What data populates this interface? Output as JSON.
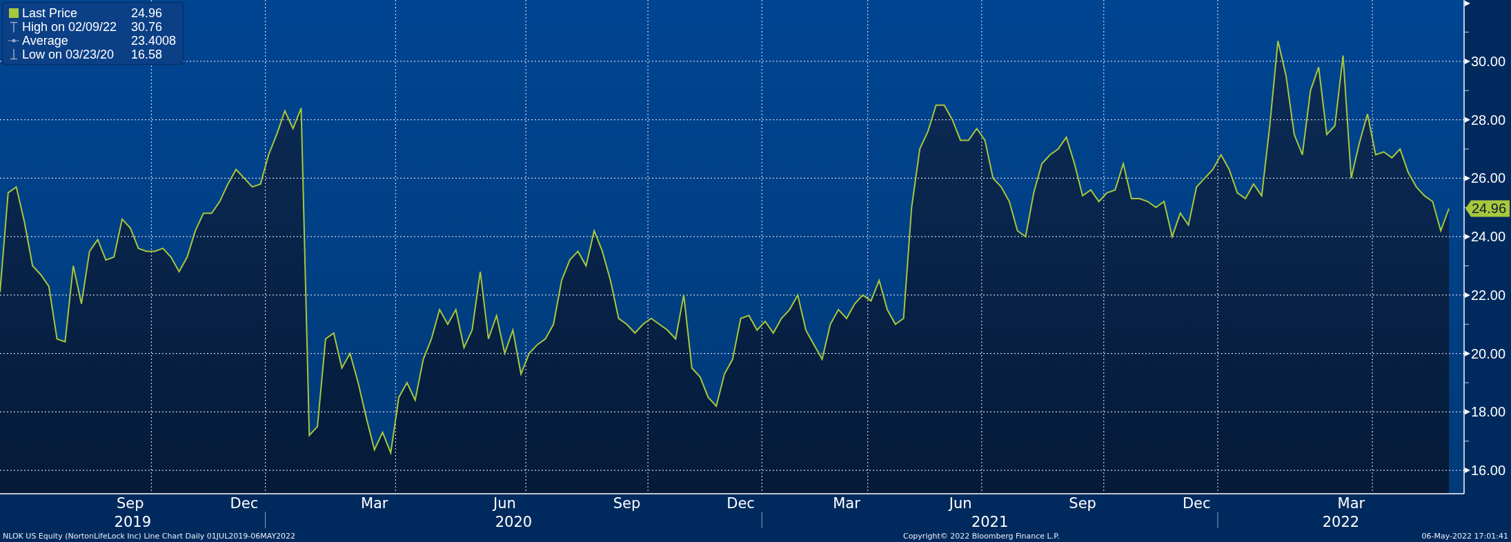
{
  "legend": [
    {
      "kind": "series",
      "value": "24.96"
    },
    {
      "kind": "high",
      "label": "High on 02/09/22",
      "value": "30.76"
    },
    {
      "kind": "average",
      "label": "Average",
      "value": "23.4008"
    },
    {
      "kind": "low",
      "label": "Low on 03/23/20",
      "value": "16.58"
    }
  ],
  "chart_data": {
    "type": "area",
    "grid": true,
    "categories": [
      null,
      null,
      null,
      null,
      null,
      null,
      null,
      null,
      null,
      null,
      null,
      null,
      null,
      null,
      null,
      null,
      "Sep",
      null,
      null,
      null,
      null,
      null,
      null,
      null,
      null,
      null,
      null,
      null,
      null,
      null,
      "Dec",
      null,
      null,
      null,
      null,
      null,
      null,
      null,
      null,
      null,
      null,
      null,
      null,
      null,
      null,
      null,
      "Mar",
      null,
      null,
      null,
      null,
      null,
      null,
      null,
      null,
      null,
      null,
      null,
      null,
      null,
      null,
      null,
      "Jun",
      null,
      null,
      null,
      null,
      null,
      null,
      null,
      null,
      null,
      null,
      null,
      null,
      null,
      null,
      "Sep",
      null,
      null,
      null,
      null,
      null,
      null,
      null,
      null,
      null,
      null,
      null,
      null,
      null,
      "Dec",
      null,
      null,
      null,
      null,
      null,
      null,
      null,
      null,
      null,
      null,
      null,
      null,
      "Mar",
      null,
      null,
      null,
      null,
      null,
      null,
      null,
      null,
      null,
      null,
      null,
      null,
      null,
      "Jun",
      null,
      null,
      null,
      null,
      null,
      null,
      null,
      null,
      null,
      null,
      null,
      null,
      null,
      null,
      "Sep",
      null,
      null,
      null,
      null,
      null,
      null,
      null,
      null,
      null,
      null,
      null,
      null,
      null,
      "Dec",
      null,
      null,
      null,
      null,
      null,
      null,
      null,
      null,
      null,
      null,
      null,
      null,
      null,
      null,
      null,
      null,
      null,
      null,
      "Mar",
      null,
      null,
      null,
      null,
      null,
      null,
      null,
      null,
      null,
      null,
      null,
      null
    ],
    "series": [
      {
        "name": "Last Price",
        "color": "#a8c83c",
        "values": [
          22.1,
          25.5,
          25.7,
          24.5,
          23,
          22.7,
          22.3,
          20.5,
          20.4,
          23,
          21.7,
          23.5,
          23.9,
          23.2,
          23.3,
          24.6,
          24.3,
          23.6,
          23.5,
          23.5,
          23.6,
          23.3,
          22.8,
          23.3,
          24.2,
          24.8,
          24.8,
          25.2,
          25.8,
          26.3,
          26.0,
          25.7,
          25.8,
          26.8,
          27.5,
          28.3,
          27.7,
          28.4,
          17.2,
          17.5,
          20.5,
          20.7,
          19.5,
          20,
          19,
          17.8,
          16.7,
          17.3,
          16.6,
          18.5,
          19,
          18.4,
          19.8,
          20.5,
          21.5,
          21,
          21.5,
          20.2,
          20.8,
          22.8,
          20.5,
          21.3,
          20,
          20.8,
          19.3,
          20,
          20.3,
          20.5,
          21,
          22.5,
          23.2,
          23.5,
          23.0,
          24.2,
          23.5,
          22.5,
          21.2,
          21,
          20.7,
          21,
          21.2,
          21,
          20.8,
          20.5,
          22,
          19.5,
          19.2,
          18.5,
          18.2,
          19.3,
          19.8,
          21.2,
          21.3,
          20.8,
          21.1,
          20.7,
          21.2,
          21.5,
          22,
          20.8,
          20.3,
          19.8,
          21,
          21.5,
          21.2,
          21.7,
          22,
          21.8,
          22.5,
          21.5,
          21.0,
          21.2,
          25,
          27.0,
          27.6,
          28.5,
          28.5,
          28.0,
          27.3,
          27.3,
          27.7,
          27.3,
          26,
          25.7,
          25.2,
          24.2,
          24.0,
          25.5,
          26.5,
          26.8,
          27,
          27.4,
          26.5,
          25.4,
          25.6,
          25.2,
          25.5,
          25.6,
          26.5,
          25.3,
          25.3,
          25.2,
          25.0,
          25.2,
          24,
          24.8,
          24.4,
          25.7,
          26,
          26.3,
          26.8,
          26.3,
          25.5,
          25.3,
          25.8,
          25.4,
          27.8,
          30.7,
          29.5,
          27.5,
          26.8,
          29,
          29.8,
          27.5,
          27.8,
          30.2,
          26.0,
          27.2,
          28.2,
          26.8,
          26.9,
          26.7,
          27,
          26.2,
          25.7,
          25.4,
          25.2,
          24.2,
          24.96
        ]
      }
    ],
    "ylim": [
      15.2,
      32.1
    ],
    "yticks": [
      {
        "value": 16,
        "label": "16.00"
      },
      {
        "value": 18,
        "label": "18.00"
      },
      {
        "value": 20,
        "label": "20.00"
      },
      {
        "value": 22,
        "label": "22.00"
      },
      {
        "value": 24,
        "label": "24.00"
      },
      {
        "value": 26,
        "label": "26.00"
      },
      {
        "value": 28,
        "label": "28.00"
      },
      {
        "value": 30,
        "label": "30.00"
      }
    ],
    "annotations": [
      "24.96"
    ]
  },
  "x_axis_years": [
    "2019",
    "2020",
    "2021",
    "2022"
  ],
  "footer": {
    "description": "NLOK US Equity (NortonLifeLock Inc) Line Chart  Daily 01JUL2019-06MAY2022",
    "copyright": "Copyright© 2022 Bloomberg Finance L.P.",
    "timestamp": "06-May-2022 17:01:41"
  }
}
